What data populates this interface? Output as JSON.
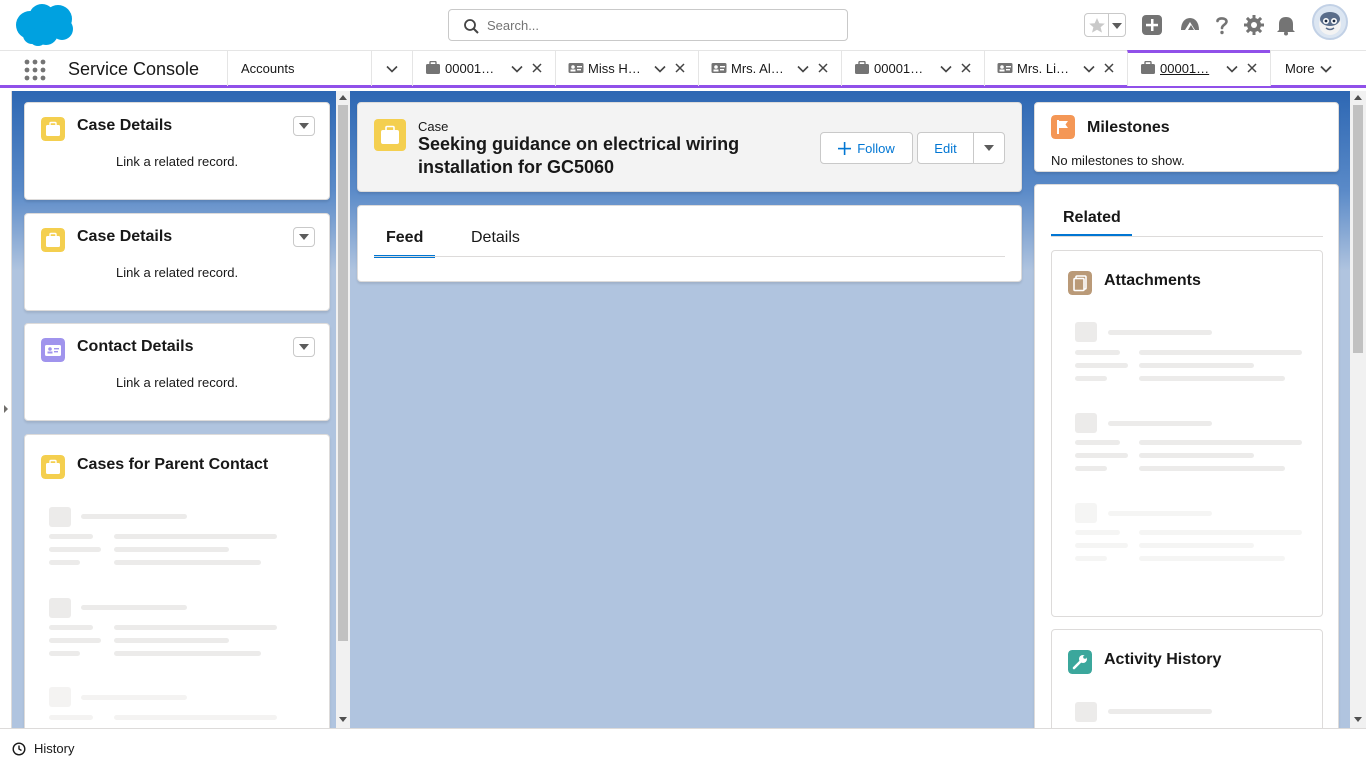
{
  "header": {
    "search_placeholder": "Search..."
  },
  "nav": {
    "app_name": "Service Console",
    "tabs": [
      {
        "label": "Accounts",
        "type": "object"
      },
      {
        "label": "00001…",
        "type": "case"
      },
      {
        "label": "Miss H…",
        "type": "contact"
      },
      {
        "label": "Mrs. Al…",
        "type": "contact"
      },
      {
        "label": "00001…",
        "type": "case"
      },
      {
        "label": "Mrs. Li…",
        "type": "contact"
      },
      {
        "label": "00001…",
        "type": "case",
        "active": true
      }
    ],
    "more_label": "More"
  },
  "left_panel": {
    "cards": [
      {
        "title": "Case Details",
        "body": "Link a related record.",
        "icon": "case-icon"
      },
      {
        "title": "Case Details",
        "body": "Link a related record.",
        "icon": "case-icon"
      },
      {
        "title": "Contact Details",
        "body": "Link a related record.",
        "icon": "contact-icon"
      },
      {
        "title": "Cases for Parent Contact",
        "icon": "case-icon"
      }
    ]
  },
  "record": {
    "object_label": "Case",
    "title": "Seeking guidance on electrical wiring installation for GC5060",
    "follow_label": "Follow",
    "edit_label": "Edit",
    "tabs": [
      {
        "label": "Feed",
        "active": true
      },
      {
        "label": "Details",
        "active": false
      }
    ]
  },
  "right_panel": {
    "milestones": {
      "title": "Milestones",
      "empty": "No milestones to show."
    },
    "related_tab": "Related",
    "attachments_title": "Attachments",
    "activity_title": "Activity History"
  },
  "footer": {
    "history_label": "History"
  },
  "colors": {
    "brand_blue": "#00a1e0",
    "accent_purple": "#9050e9",
    "link_blue": "#0176d3",
    "case_yellow": "#f4cf4f",
    "contact_purple": "#a094ed",
    "milestone_orange": "#f49756",
    "attachment_brown": "#ba9a78",
    "activity_green": "#3ba79c"
  }
}
